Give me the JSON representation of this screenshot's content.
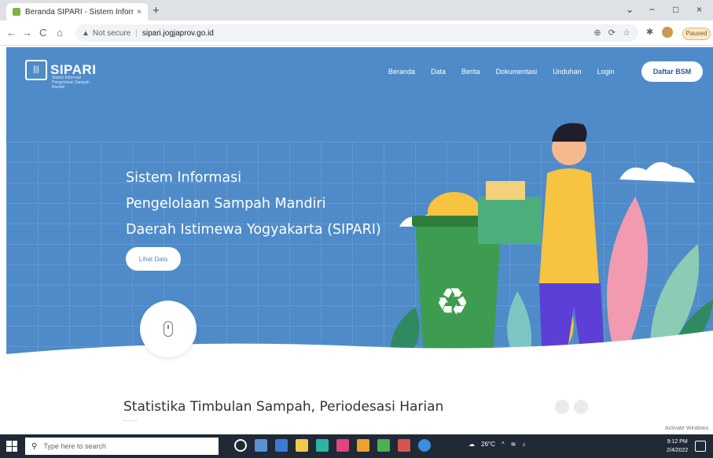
{
  "browser": {
    "tab_title": "Beranda SIPARI - Sistem Inform...",
    "tab_close": "×",
    "new_tab": "+",
    "win_controls": [
      "⌄",
      "−",
      "□",
      "×"
    ],
    "nav_back": "←",
    "nav_forward": "→",
    "nav_reload": "C",
    "nav_home": "⌂",
    "security_label": "Not secure",
    "security_icon": "▲",
    "separator": "|",
    "url": "sipari.jogjaprov.go.id",
    "omni_right_icons": [
      "⊕",
      "⟳",
      "☆"
    ],
    "profile_label": "Paused"
  },
  "site": {
    "logo_icon": "|||",
    "logo_text": "SIPARI",
    "logo_sub": "Sistem Informasi Pengelolaan Sampah Mandiri",
    "nav_items": [
      "Beranda",
      "Data",
      "Berita",
      "Dokumentasi",
      "Unduhan",
      "Login"
    ],
    "cta_label": "Daftar BSM",
    "headline_lines": [
      "Sistem Informasi",
      "Pengelolaan Sampah Mandiri",
      "Daerah Istimewa Yogyakarta (SIPARI)"
    ],
    "readmore_label": "Lihat Data",
    "section_title": "Statistika Timbulan Sampah, Periodesasi Harian",
    "section_sub": "— — —",
    "activate_text": "Activate Windows"
  },
  "taskbar": {
    "search_placeholder": "Type here to search",
    "search_icon": "⚲",
    "tray_text": "26°C",
    "tray_arrow": "^",
    "time": "9:12 PM",
    "date": "2/4/2022"
  },
  "colors": {
    "hero_blue": "#4f8bc9",
    "taskbar": "#1f2a36",
    "bin_green": "#3d9c4f",
    "shirt_yellow": "#f7c341",
    "pants_purple": "#5b3fd6"
  }
}
